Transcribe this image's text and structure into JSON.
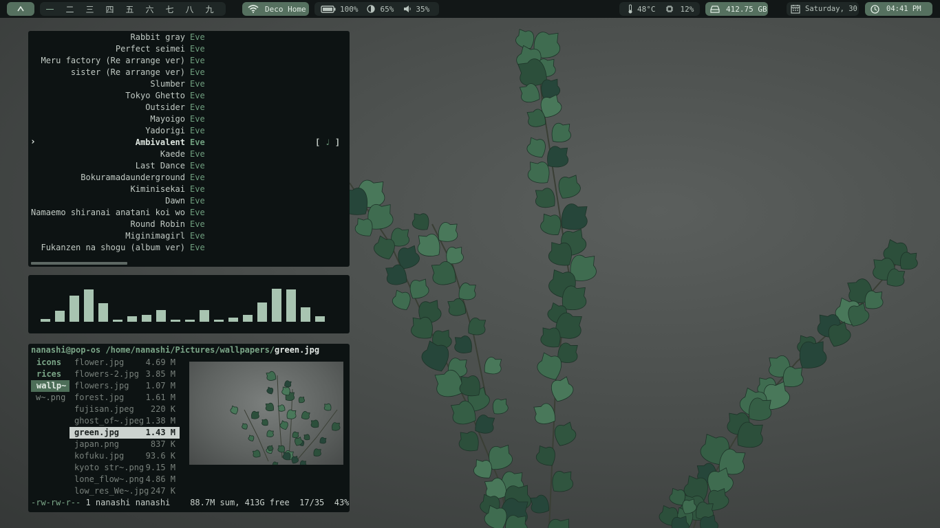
{
  "topbar": {
    "launcher_icon": "caret-up-icon",
    "workspaces": [
      "一",
      "二",
      "三",
      "四",
      "五",
      "六",
      "七",
      "八",
      "九"
    ],
    "active_workspace": 0,
    "wifi": {
      "icon": "wifi-icon",
      "label": "Deco Home"
    },
    "battery": {
      "icon": "battery-icon",
      "value": "100%"
    },
    "brightness": {
      "icon": "brightness-icon",
      "value": "65%"
    },
    "volume": {
      "icon": "volume-icon",
      "value": "35%"
    },
    "temperature": {
      "icon": "thermometer-icon",
      "value": "48°C"
    },
    "cpu": {
      "icon": "cpu-icon",
      "value": "12%"
    },
    "disk": {
      "icon": "hard-drive-icon",
      "value": "412.75 GB"
    },
    "date": {
      "icon": "calendar-icon",
      "value": "Saturday, 30"
    },
    "time": {
      "icon": "clock-icon",
      "value": "04:41 PM"
    }
  },
  "playlist": {
    "tracks": [
      {
        "title": "Rabbit gray",
        "artist": "Eve"
      },
      {
        "title": "Perfect seimei",
        "artist": "Eve"
      },
      {
        "title": "Meru factory (Re arrange ver)",
        "artist": "Eve"
      },
      {
        "title": "sister (Re arrange ver)",
        "artist": "Eve"
      },
      {
        "title": "Slumber",
        "artist": "Eve"
      },
      {
        "title": "Tokyo Ghetto",
        "artist": "Eve"
      },
      {
        "title": "Outsider",
        "artist": "Eve"
      },
      {
        "title": "Mayoigo",
        "artist": "Eve"
      },
      {
        "title": "Yadorigi",
        "artist": "Eve"
      },
      {
        "title": "Ambivalent",
        "artist": "Eve"
      },
      {
        "title": "Kaede",
        "artist": "Eve"
      },
      {
        "title": "Last Dance",
        "artist": "Eve"
      },
      {
        "title": "Bokuramadaunderground",
        "artist": "Eve"
      },
      {
        "title": "Kiminisekai",
        "artist": "Eve"
      },
      {
        "title": "Dawn",
        "artist": "Eve"
      },
      {
        "title": "Namaemo shiranai anatani koi wo",
        "artist": "Eve"
      },
      {
        "title": "Round Robin",
        "artist": "Eve"
      },
      {
        "title": "Miginimagirl",
        "artist": "Eve"
      },
      {
        "title": "Fukanzen na shogu (album ver)",
        "artist": "Eve"
      }
    ],
    "selected_index": 9,
    "selection_marker": "›",
    "playing_tag": {
      "open": "[ ",
      "note": "♩",
      "close": " ]"
    }
  },
  "visualizer": {
    "levels": [
      0.08,
      0.33,
      0.79,
      0.98,
      0.56,
      0.04,
      0.17,
      0.21,
      0.35,
      0.04,
      0.04,
      0.35,
      0.04,
      0.13,
      0.21,
      0.58,
      1.0,
      0.98,
      0.44,
      0.17
    ],
    "color": "#a8c4b1"
  },
  "filemanager": {
    "path": {
      "user": "nanashi@pop-os",
      "dir": "/home/nanashi/Pictures/wallpapers/",
      "file": "green.jpg"
    },
    "parent_entries": [
      "icons",
      "rices",
      "wallp~",
      "w~.png"
    ],
    "parent_current": 2,
    "files": [
      {
        "name": "flower.jpg",
        "size": "4.69 M"
      },
      {
        "name": "flowers-2.jpg",
        "size": "3.85 M"
      },
      {
        "name": "flowers.jpg",
        "size": "1.07 M"
      },
      {
        "name": "forest.jpg",
        "size": "1.61 M"
      },
      {
        "name": "fujisan.jpeg",
        "size": "220 K"
      },
      {
        "name": "ghost_of~.jpeg",
        "size": "1.38 M"
      },
      {
        "name": "green.jpg",
        "size": "1.43 M"
      },
      {
        "name": "japan.png",
        "size": "837 K"
      },
      {
        "name": "kofuku.jpg",
        "size": "93.6 K"
      },
      {
        "name": "kyoto str~.png",
        "size": "9.15 M"
      },
      {
        "name": "lone_flow~.png",
        "size": "4.86 M"
      },
      {
        "name": "low_res_We~.jpg",
        "size": "247 K"
      }
    ],
    "current_file": 6,
    "status": {
      "perms": "-rw-rw-r--",
      "owner": " 1 nanashi nanashi",
      "summary": "88.7M sum, 413G free",
      "position": "17/35",
      "percent": "43%"
    }
  },
  "colors": {
    "accent": "#55705f",
    "bar_bg": "#121717",
    "panel_bg": "#0d1313",
    "ivy": "#2f5a40"
  }
}
